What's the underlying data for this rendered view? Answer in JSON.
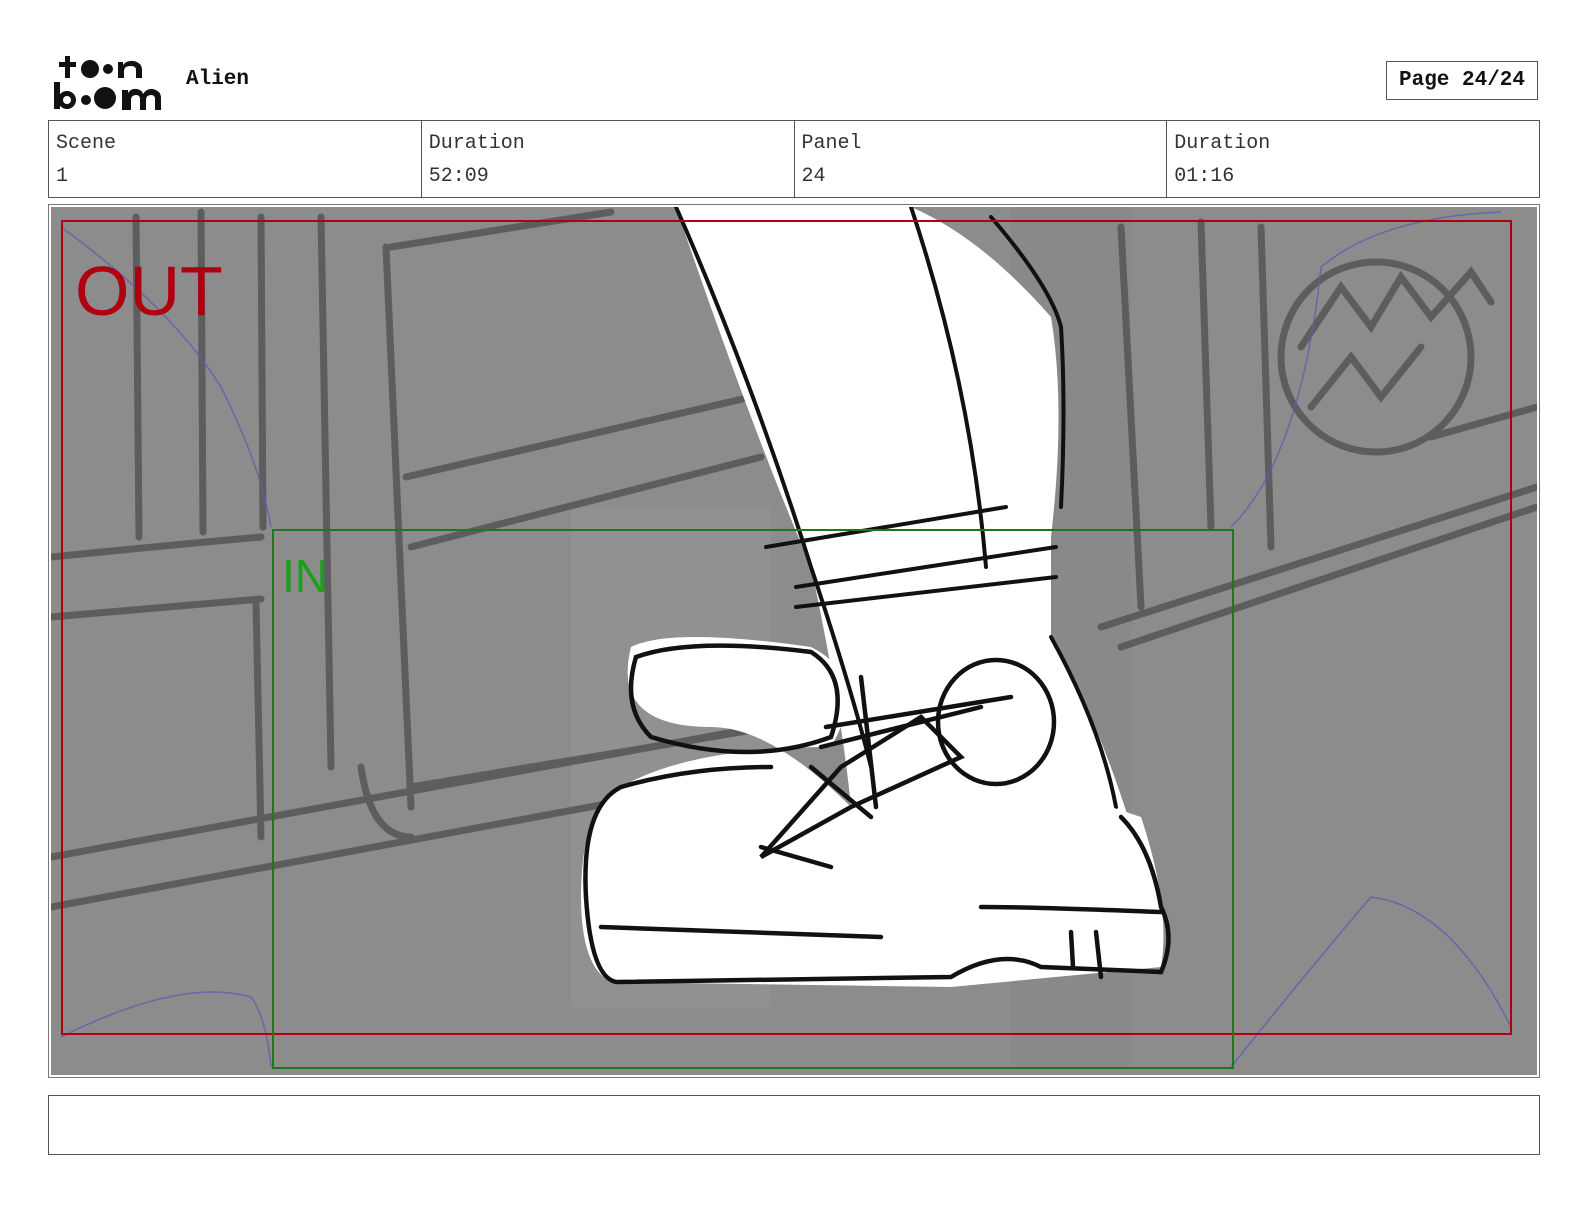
{
  "header": {
    "logo_text": "toon boom",
    "project_title": "Alien",
    "page_label": "Page 24/24"
  },
  "info": {
    "scene_label": "Scene",
    "scene_value": "1",
    "scene_duration_label": "Duration",
    "scene_duration_value": "52:09",
    "panel_label": "Panel",
    "panel_value": "24",
    "panel_duration_label": "Duration",
    "panel_duration_value": "01:16"
  },
  "panel": {
    "out_label": "OUT",
    "in_label": "IN",
    "out_color": "#b00010",
    "in_color": "#1a8a1a",
    "background_color": "#8c8c8c"
  },
  "notes": {
    "text": ""
  }
}
